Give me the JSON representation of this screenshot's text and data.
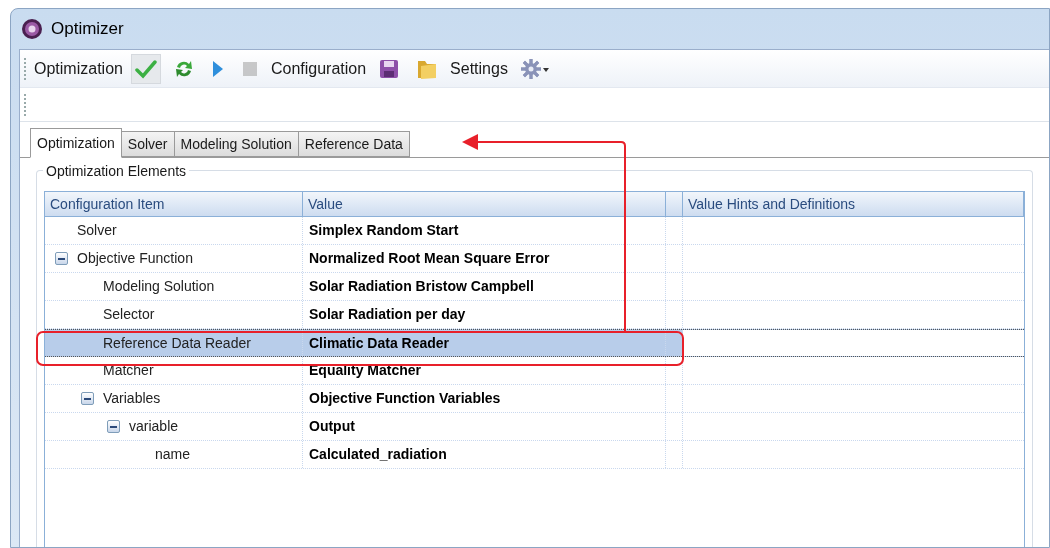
{
  "window": {
    "title": "Optimizer"
  },
  "toolbar": {
    "items": [
      {
        "kind": "label",
        "text": "Optimization"
      },
      {
        "kind": "check",
        "pressed": true
      },
      {
        "kind": "refresh",
        "pressed": false
      },
      {
        "kind": "play",
        "pressed": false
      },
      {
        "kind": "stop",
        "disabled": true
      },
      {
        "kind": "label",
        "text": "Configuration"
      },
      {
        "kind": "save",
        "pressed": false
      },
      {
        "kind": "folder",
        "pressed": false
      },
      {
        "kind": "label",
        "text": "Settings"
      },
      {
        "kind": "gear",
        "pressed": false
      }
    ]
  },
  "tabs": [
    {
      "label": "Optimization",
      "selected": true
    },
    {
      "label": "Solver",
      "selected": false
    },
    {
      "label": "Modeling Solution",
      "selected": false
    },
    {
      "label": "Reference Data",
      "selected": false
    }
  ],
  "group": {
    "title": "Optimization Elements"
  },
  "grid": {
    "columns": [
      "Configuration Item",
      "Value",
      "",
      "Value Hints and Definitions"
    ],
    "rows": [
      {
        "item": "Solver",
        "value": "Simplex Random Start",
        "selected": false
      },
      {
        "item": "Objective Function",
        "value": "Normalized Root Mean Square Error",
        "selected": false,
        "expanded": true,
        "children": [
          {
            "item": "Modeling Solution",
            "value": "Solar Radiation Bristow Campbell",
            "selected": false
          },
          {
            "item": "Selector",
            "value": "Solar Radiation per day",
            "selected": false
          },
          {
            "item": "Reference Data Reader",
            "value": "Climatic Data Reader",
            "selected": true
          },
          {
            "item": "Matcher",
            "value": "Equality Matcher",
            "selected": false
          },
          {
            "item": "Variables",
            "value": "Objective Function Variables",
            "selected": false,
            "expanded": true,
            "children": [
              {
                "item": "variable",
                "value": "Output",
                "selected": false,
                "expanded": true,
                "children": [
                  {
                    "item": "name",
                    "value": "Calculated_radiation",
                    "selected": false
                  }
                ]
              }
            ]
          }
        ]
      }
    ]
  }
}
